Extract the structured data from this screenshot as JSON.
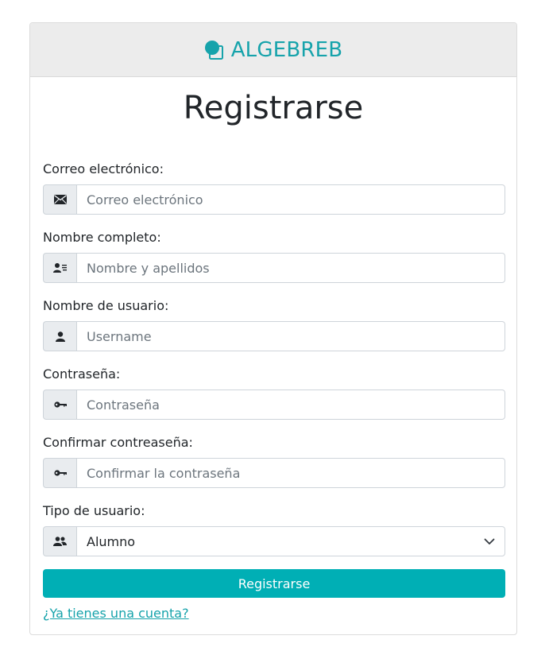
{
  "brand": {
    "name": "ALGEBREB",
    "color": "#16a3ab",
    "icon": "shapes-icon"
  },
  "title": "Registrarse",
  "fields": [
    {
      "label": "Correo electrónico:",
      "placeholder": "Correo electrónico",
      "icon": "envelope-icon"
    },
    {
      "label": "Nombre completo:",
      "placeholder": "Nombre y apellidos",
      "icon": "id-card-icon"
    },
    {
      "label": "Nombre de usuario:",
      "placeholder": "Username",
      "icon": "user-icon"
    },
    {
      "label": "Contraseña:",
      "placeholder": "Contraseña",
      "icon": "key-icon"
    },
    {
      "label": "Confirmar contreaseña:",
      "placeholder": "Confirmar la contraseña",
      "icon": "key-icon"
    }
  ],
  "user_type": {
    "label": "Tipo de usuario:",
    "selected": "Alumno",
    "icon": "users-icon"
  },
  "submit_label": "Registrarse",
  "login_link": "¿Ya tienes una cuenta?",
  "accent_color": "#00afb5"
}
